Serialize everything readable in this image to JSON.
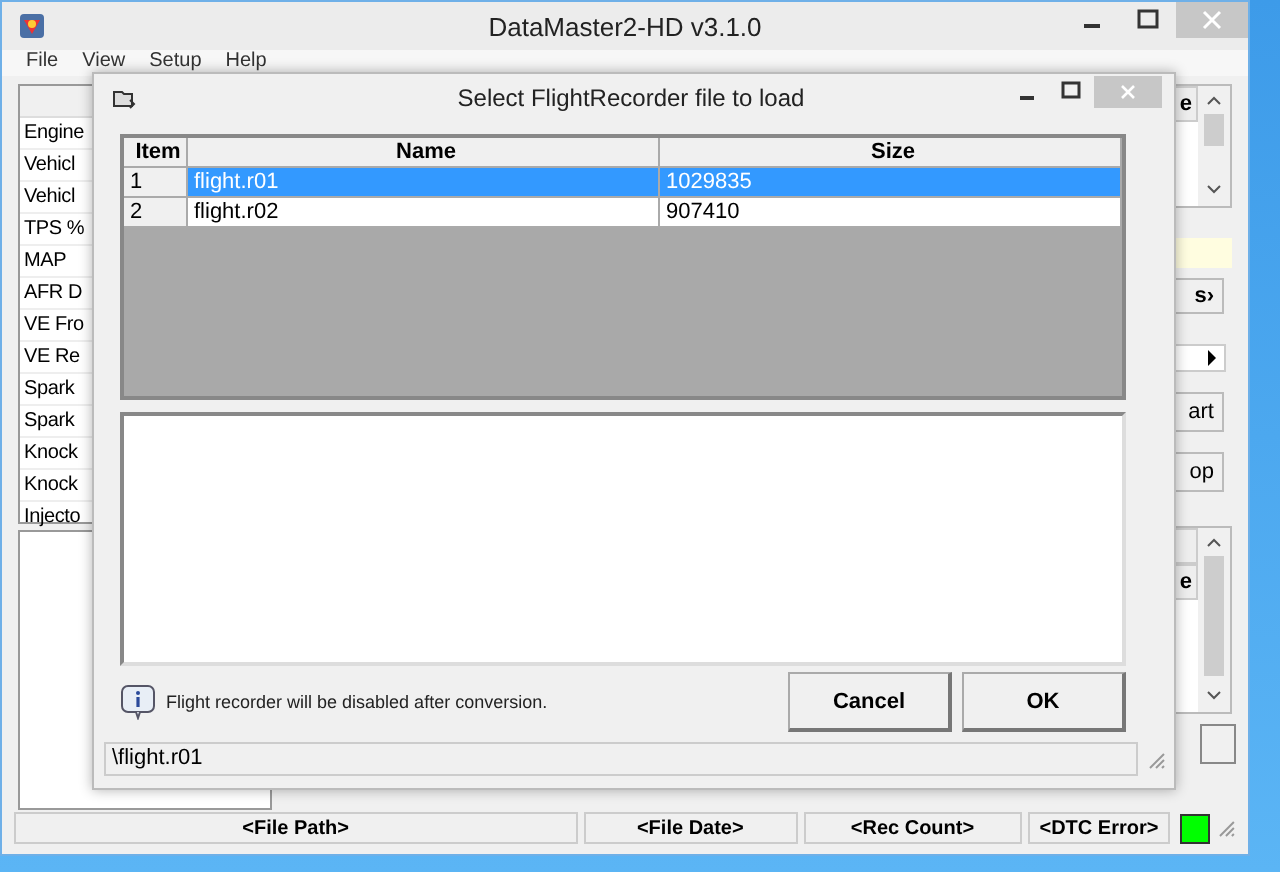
{
  "window": {
    "title": "DataMaster2-HD  v3.1.0"
  },
  "menu": [
    "File",
    "View",
    "Setup",
    "Help"
  ],
  "left_list": [
    "Engine",
    "Vehicl",
    "Vehicl",
    "TPS %",
    "MAP",
    "AFR D",
    "VE Fro",
    "VE Re",
    "Spark",
    "Spark",
    "Knock",
    "Knock",
    "Injecto"
  ],
  "right_panel": {
    "table_header_1": "e",
    "button_1": "s›",
    "button_2": "art",
    "button_3": "op",
    "table_header_2": "e"
  },
  "dialog": {
    "title": "Select FlightRecorder file to load",
    "columns": [
      "Item",
      "Name",
      "Size"
    ],
    "rows": [
      {
        "item": "1",
        "name": "flight.r01",
        "size": "1029835",
        "selected": true
      },
      {
        "item": "2",
        "name": "flight.r02",
        "size": "907410",
        "selected": false
      }
    ],
    "info": "Flight recorder will be disabled after conversion.",
    "buttons": [
      "Cancel",
      "OK"
    ],
    "path": "\\flight.r01"
  },
  "status_bar": [
    {
      "text": "<File Path>"
    },
    {
      "text": "<File Date>"
    },
    {
      "text": "<Rec Count>"
    },
    {
      "text": "<DTC Error>"
    }
  ],
  "indicator": {
    "color": "#00ff00"
  }
}
